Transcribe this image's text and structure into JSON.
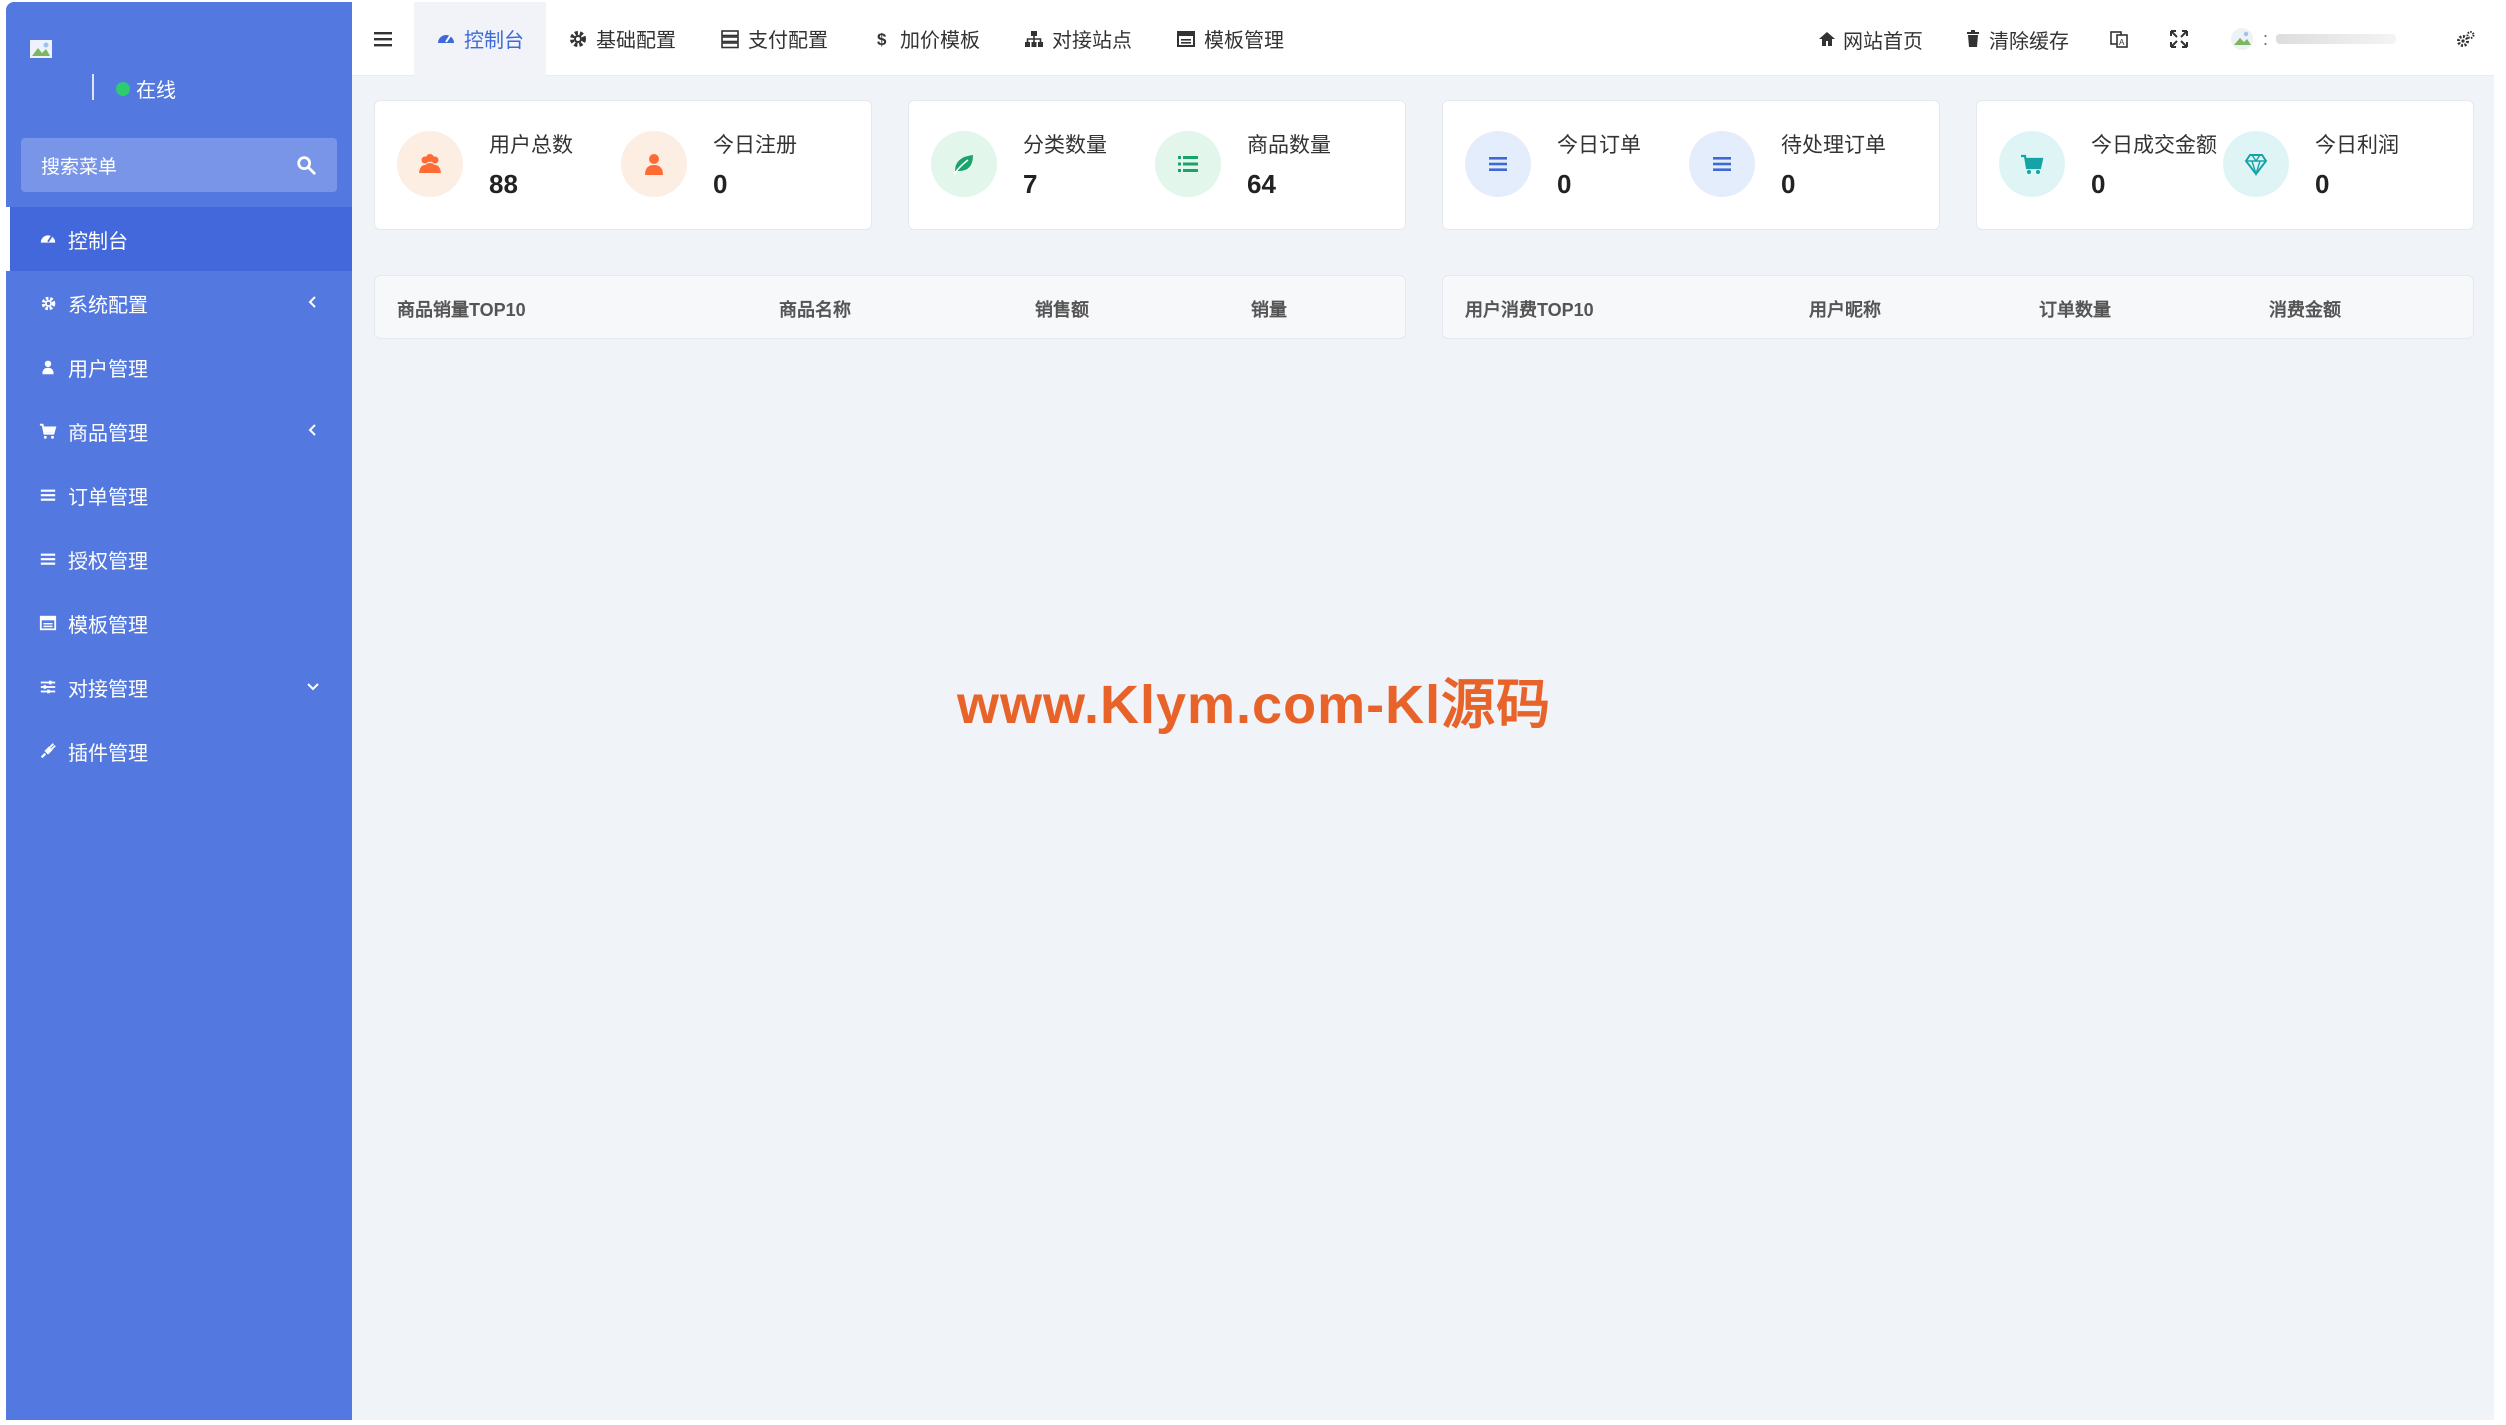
{
  "sidebar": {
    "status": "在线",
    "search_placeholder": "搜索菜单",
    "items": [
      {
        "label": "控制台",
        "icon": "dashboard-icon",
        "active": true
      },
      {
        "label": "系统配置",
        "icon": "gear-icon",
        "arrow": "chevron-left-icon"
      },
      {
        "label": "用户管理",
        "icon": "user-icon"
      },
      {
        "label": "商品管理",
        "icon": "cart-icon",
        "arrow": "chevron-left-icon"
      },
      {
        "label": "订单管理",
        "icon": "list-icon"
      },
      {
        "label": "授权管理",
        "icon": "list-icon"
      },
      {
        "label": "模板管理",
        "icon": "window-icon"
      },
      {
        "label": "对接管理",
        "icon": "sliders-icon",
        "arrow": "chevron-down-icon"
      },
      {
        "label": "插件管理",
        "icon": "plug-icon"
      }
    ]
  },
  "topbar": {
    "tabs": [
      {
        "label": "控制台",
        "icon": "dashboard-icon",
        "active": true
      },
      {
        "label": "基础配置",
        "icon": "gear-icon"
      },
      {
        "label": "支付配置",
        "icon": "server-icon"
      },
      {
        "label": "加价模板",
        "icon": "dollar-icon"
      },
      {
        "label": "对接站点",
        "icon": "sitemap-icon"
      },
      {
        "label": "模板管理",
        "icon": "window-icon"
      }
    ],
    "right": {
      "home": "网站首页",
      "clear_cache": "清除缓存",
      "username_prefix": ":"
    }
  },
  "stats": [
    {
      "label": "用户总数",
      "value": "88",
      "icon": "users-icon",
      "color": "#ff6b35",
      "bg": "#fdeee3"
    },
    {
      "label": "今日注册",
      "value": "0",
      "icon": "user-icon",
      "color": "#ff6b35",
      "bg": "#fdeee3"
    },
    {
      "label": "分类数量",
      "value": "7",
      "icon": "leaf-icon",
      "color": "#1aa36b",
      "bg": "#e2f6ec"
    },
    {
      "label": "商品数量",
      "value": "64",
      "icon": "list-icon",
      "color": "#1aa36b",
      "bg": "#e2f6ec"
    },
    {
      "label": "今日订单",
      "value": "0",
      "icon": "list-icon",
      "color": "#3d6ad8",
      "bg": "#e3edfb"
    },
    {
      "label": "待处理订单",
      "value": "0",
      "icon": "list-icon",
      "color": "#3d6ad8",
      "bg": "#e3edfb"
    },
    {
      "label": "今日成交金额",
      "value": "0",
      "icon": "cart-icon",
      "color": "#16a3a8",
      "bg": "#dff5f5"
    },
    {
      "label": "今日利润",
      "value": "0",
      "icon": "diamond-icon",
      "color": "#16a3a8",
      "bg": "#dff5f5"
    }
  ],
  "tables": {
    "goods": {
      "headers": [
        "商品销量TOP10",
        "商品名称",
        "销售额",
        "销量"
      ]
    },
    "users": {
      "headers": [
        "用户消费TOP10",
        "用户昵称",
        "订单数量",
        "消费金额"
      ]
    }
  },
  "watermark": "www.Klym.com-Kl源码",
  "colors": {
    "sidebar": "#5378e0",
    "accent": "#3d6ad8",
    "content_bg": "#f0f3f7"
  }
}
